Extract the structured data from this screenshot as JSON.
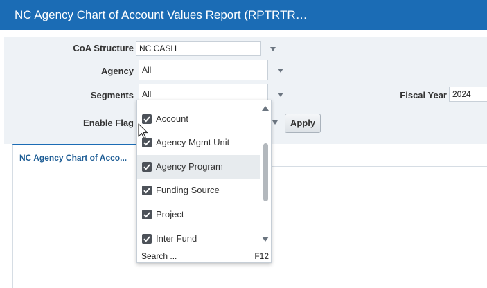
{
  "header": {
    "title": "NC Agency Chart of Account Values Report (RPTRTR…"
  },
  "params": {
    "coa_structure": {
      "label": "CoA Structure",
      "value": "NC CASH"
    },
    "agency": {
      "label": "Agency",
      "value": "All"
    },
    "segments": {
      "label": "Segments",
      "value": "All"
    },
    "enable_flag": {
      "label": "Enable Flag"
    },
    "fiscal_year": {
      "label": "Fiscal Year",
      "value": "2024"
    },
    "apply_label": "Apply"
  },
  "tab": {
    "label": "NC Agency Chart of Acco..."
  },
  "dropdown": {
    "options": [
      {
        "label": "Account",
        "checked": true
      },
      {
        "label": "Agency Mgmt Unit",
        "checked": true
      },
      {
        "label": "Agency Program",
        "checked": true,
        "highlighted": true
      },
      {
        "label": "Funding Source",
        "checked": true
      },
      {
        "label": "Project",
        "checked": true
      },
      {
        "label": "Inter Fund",
        "checked": true
      }
    ],
    "search_label": "Search ...",
    "search_shortcut": "F12"
  },
  "colors": {
    "header_bg": "#1b6cb5",
    "panel_bg": "#eef2f6",
    "checkbox": "#4d5259"
  }
}
